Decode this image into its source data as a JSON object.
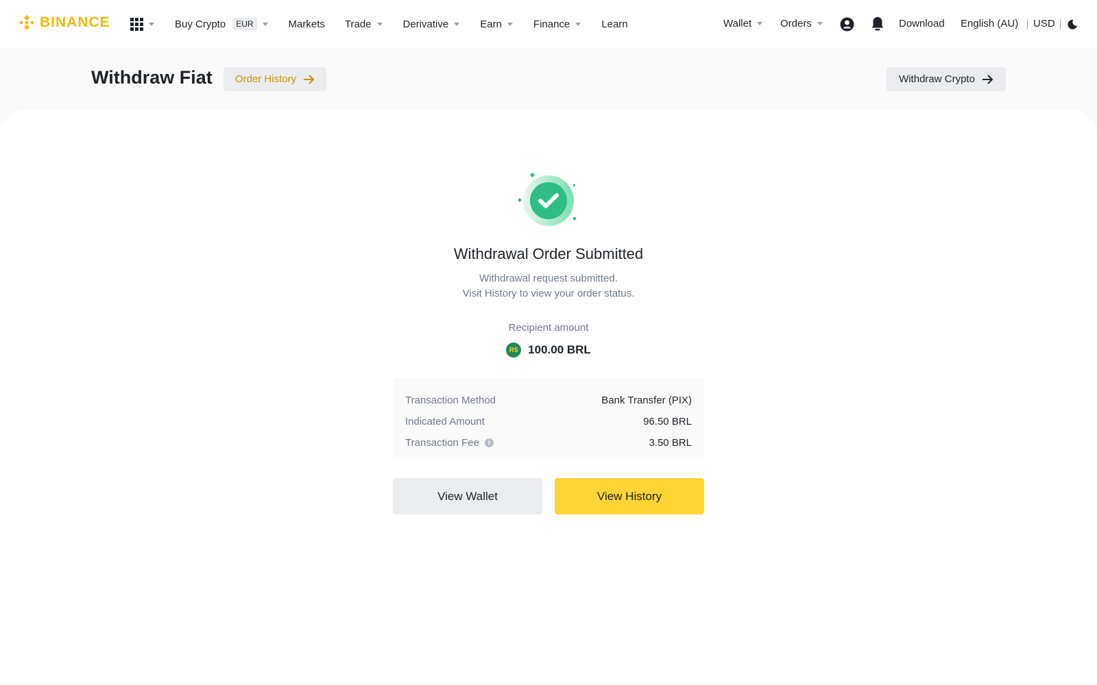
{
  "header": {
    "logo_text": "BINANCE",
    "nav": {
      "buy_crypto": "Buy Crypto",
      "buy_crypto_badge": "EUR",
      "markets": "Markets",
      "trade": "Trade",
      "derivative": "Derivative",
      "earn": "Earn",
      "finance": "Finance",
      "learn": "Learn"
    },
    "right": {
      "wallet": "Wallet",
      "orders": "Orders",
      "download": "Download",
      "language": "English (AU)",
      "currency": "USD"
    }
  },
  "subheader": {
    "title": "Withdraw Fiat",
    "order_history_label": "Order History",
    "withdraw_crypto_label": "Withdraw Crypto"
  },
  "result": {
    "title": "Withdrawal Order Submitted",
    "subtitle_line1": "Withdrawal request submitted.",
    "subtitle_line2": "Visit History to view your order status.",
    "recipient_label": "Recipient amount",
    "currency_symbol": "R$",
    "recipient_amount": "100.00 BRL"
  },
  "details": [
    {
      "label": "Transaction Method",
      "value": "Bank Transfer (PIX)"
    },
    {
      "label": "Indicated Amount",
      "value": "96.50 BRL"
    },
    {
      "label": "Transaction Fee",
      "value": "3.50 BRL"
    }
  ],
  "actions": {
    "view_wallet": "View Wallet",
    "view_history": "View History"
  },
  "colors": {
    "brand": "#f0b90b",
    "primary_button": "#fcd535",
    "success": "#2ebd85"
  }
}
